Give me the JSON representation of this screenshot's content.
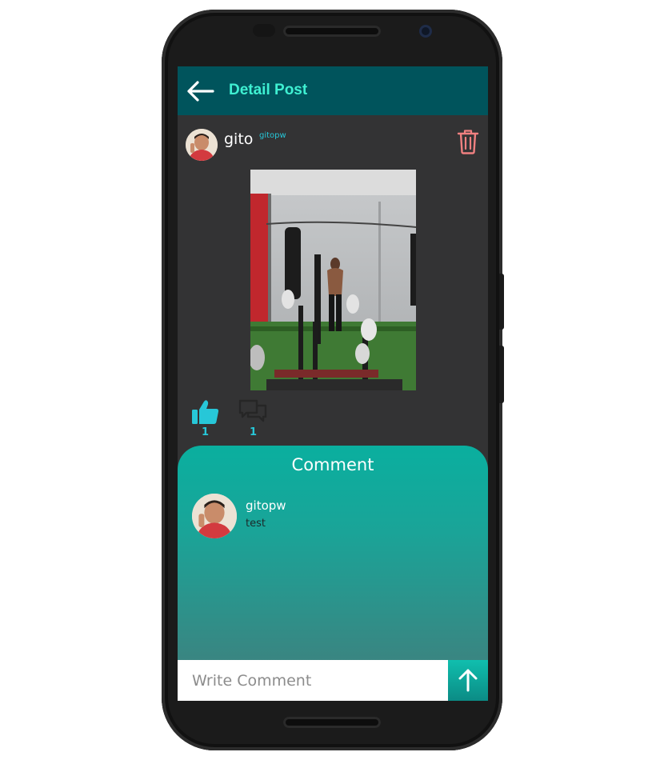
{
  "header": {
    "title": "Detail Post"
  },
  "post": {
    "author_name": "gito",
    "author_handle": "gitopw",
    "likes": "1",
    "comments": "1"
  },
  "comments_panel": {
    "title": "Comment",
    "items": [
      {
        "user": "gitopw",
        "text": "test"
      }
    ]
  },
  "composer": {
    "placeholder": "Write Comment"
  },
  "icons": {
    "back": "arrow-left-icon",
    "delete": "trash-icon",
    "like": "thumbs-up-icon",
    "comment": "chat-bubbles-icon",
    "send": "arrow-up-icon"
  },
  "colors": {
    "appbar": "#00545c",
    "title": "#3ff0d2",
    "accent": "#27c7d8",
    "delete": "#f08080",
    "panel_top": "#0aaf9f",
    "panel_bottom": "#3a8581"
  }
}
